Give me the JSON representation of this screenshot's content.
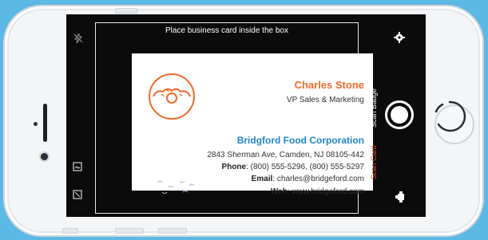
{
  "camera": {
    "hint": "Place business card inside the box",
    "modes": [
      "Scan Badge",
      "Scan Card"
    ],
    "active_mode": "Scan Card"
  },
  "card": {
    "name": "Charles Stone",
    "title": "VP Sales & Marketing",
    "company": "Bridgford Food Corporation",
    "address": "2843 Sherman Ave, Camden, NJ 08105-442",
    "phone_label": "Phone",
    "phone_value": ": (800) 555-5296, (800) 555-5297",
    "email_label": "Email",
    "email_value": ": charles@bridgeford.com",
    "web_label": "Web",
    "web_value": ": www.bridgeford.com"
  },
  "icons": {
    "flash": "flash-icon",
    "photos": "photo-library-icon",
    "crop": "crop-icon",
    "settings": "gear-icon",
    "shutter": "shutter-button",
    "switch_camera": "rotate-camera-icon",
    "logo": "donut-logo-icon"
  },
  "colors": {
    "background": "#5cb8e4",
    "accent_orange": "#ee6a28",
    "accent_blue": "#1f86c9",
    "active_mode": "#e64b3c"
  }
}
